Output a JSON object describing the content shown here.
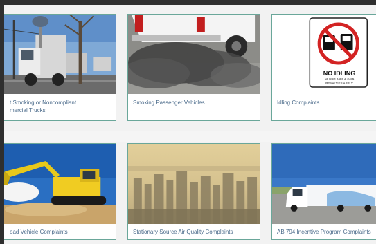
{
  "cards": [
    {
      "label_lines": [
        "t Smoking or Noncompliant",
        "mercial Trucks"
      ],
      "image": "smoking-truck-image"
    },
    {
      "label_lines": [
        "Smoking Passenger Vehicles"
      ],
      "image": "smoking-car-exhaust-image"
    },
    {
      "label_lines": [
        "Idling Complaints"
      ],
      "image": "no-idling-sign-image"
    },
    {
      "label_lines": [
        "oad Vehicle Complaints"
      ],
      "image": "excavator-image"
    },
    {
      "label_lines": [
        "Stationary Source Air Quality Complaints"
      ],
      "image": "hazy-city-skyline-image"
    },
    {
      "label_lines": [
        "AB 794 Incentive Program Complaints"
      ],
      "image": "electric-truck-image"
    }
  ],
  "sign": {
    "title": "NO IDLING",
    "line1": "13 CCR 2480 & 2485",
    "line2": "PENALTIES APPLY"
  },
  "colors": {
    "card_border": "#6aa79a",
    "label_text": "#4a6a8a",
    "page_background": "#f2f2f2"
  }
}
